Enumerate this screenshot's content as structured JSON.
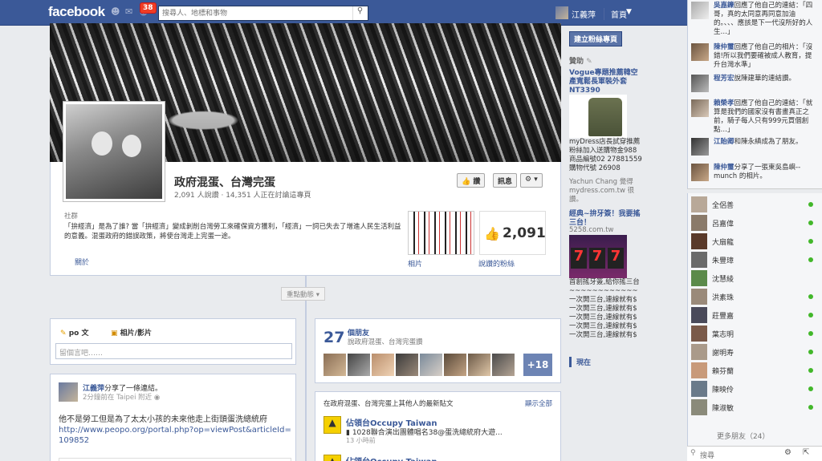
{
  "topbar": {
    "logo": "facebook",
    "notifications_count": "38",
    "search_placeholder": "搜尋人、地標和事物",
    "user_name": "江義萍",
    "home": "首頁"
  },
  "page": {
    "title": "政府混蛋、台灣完蛋",
    "stats": "2,091 人說讚 · 14,351 人正在討論這專頁",
    "like_button": "讚",
    "message_button": "訊息",
    "category": "社群",
    "about_text": "「拚經濟」是為了誰? 當「拚經濟」變成剝削台灣勞工來確保資方獲利，「經濟」一詞已失去了增進人民生活利益的意義。混蛋政府的錯誤政策，將使台灣走上完蛋一途。",
    "about_link": "關於",
    "photos_label": "相片",
    "likes_count": "2,091",
    "likes_label": "說讚的粉絲",
    "highlights": "重點動態"
  },
  "composer": {
    "tab_post": "po 文",
    "tab_photo": "相片/影片",
    "placeholder": "留個言吧……"
  },
  "post1": {
    "author": "江義萍",
    "action": "分享了一條連結。",
    "meta": "2分鐘前在 Taipei 附近",
    "body": "他不是勞工但是為了太太小孩的未來他走上街頭蛋洗總統府",
    "url": "http://www.peopo.org/portal.php?op=viewPost&articleId=109852"
  },
  "friends_card": {
    "count": "27",
    "label": "個朋友",
    "sub": "說政府混蛋、台灣完蛋讚",
    "more": "+18"
  },
  "posts_card": {
    "header": "在政府混蛋、台灣完蛋上其他人的最新貼文",
    "see_all": "顯示全部",
    "items": [
      {
        "name": "佔領台Occupy Taiwan",
        "text": "1028聯合演出團體唱名38@蛋洗總統府大遊...",
        "time": "13 小時前"
      },
      {
        "name": "佔領台Occupy Taiwan",
        "text": "",
        "time": ""
      }
    ]
  },
  "ads": {
    "create_page": "建立粉絲專頁",
    "sponsored": "贊助",
    "ad1_title": "Vogue專題推薦韓空產寬鬆長軍裝外套NT3390",
    "ad1_body": "myDress店長試穿推薦 粉絲加入送購物金988 商品編號02 27881559 購物代號 26908",
    "ad1_social": "Yachun Chang 覺得 mydress.com.tw 很讚。",
    "ad2_title": "經典~拚牙簽！我要搖三台！",
    "ad2_url": "5258.com.tw",
    "ad2_body": "首創搖牙簽,給你搖三台 ~~~~~~~~~~~~ 一次開三台,連線就有$ 一次開三台,連線就有$ 一次開三台,連線就有$ 一次開三台,連線就有$ 一次開三台,連線就有$",
    "now": "現在"
  },
  "ticker": [
    {
      "name": "吳嘉鑠",
      "text": "回應了他自己的連結：「四哥，真的太同意再同意加油的。、、、應該是下一代沒所好的人生…」"
    },
    {
      "name": "陳仲璽",
      "text": "回應了他自己的相片：「沒錯!所以我們要確被成人教育，提升台灣水準」"
    },
    {
      "name": "程芳宏",
      "text": "說陳建華的連結讚。"
    },
    {
      "name": "賴榮孝",
      "text": "回應了他自己的連結：「就算是我們的國家沒有書畫真正之前，騎子每人只有999元買個創點…」"
    },
    {
      "name": "江貽卿",
      "text": "和陳永縝成為了朋友。"
    },
    {
      "name": "陳仲璽",
      "text": "分享了一張東吳島嶼--munch 的相片。"
    }
  ],
  "chat": {
    "friends": [
      "全侶善",
      "呂嘉偉",
      "大扇龍",
      "朱豐璋",
      "沈慧綾",
      "洪素珠",
      "莊豐嘉",
      "葉志明",
      "謝明寿",
      "賴芬蘭",
      "陳映伶",
      "陳淑敏"
    ],
    "more_friends": "更多朋友（24）",
    "search_placeholder": "搜尋"
  },
  "colors": {
    "brand": "#3b5998",
    "online": "#42b72a",
    "notification": "#f03d25"
  }
}
